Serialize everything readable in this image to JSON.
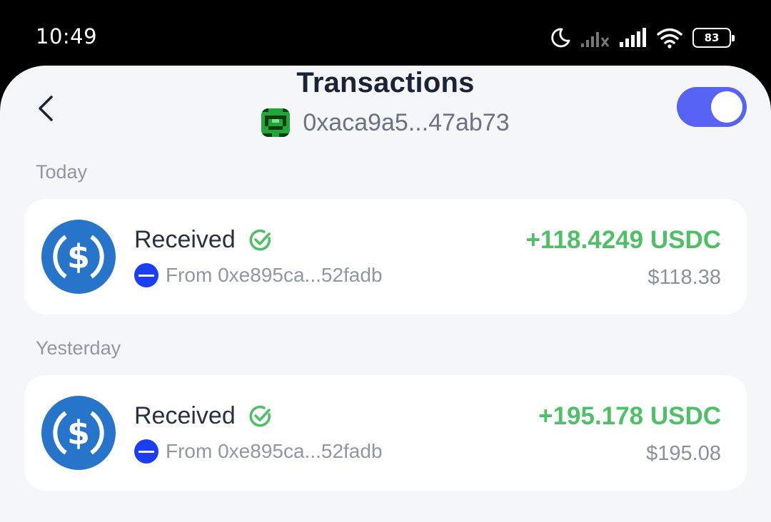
{
  "status_bar": {
    "time": "10:49",
    "battery": "83",
    "icons": [
      "moon-icon",
      "signal-off-icon",
      "signal-icon",
      "wifi-icon",
      "battery-icon"
    ]
  },
  "header": {
    "title": "Transactions",
    "address": "0xaca9a5...47ab73",
    "toggle_on": true,
    "accent_color": "#5663f4"
  },
  "sections": [
    {
      "label": "Today",
      "transactions": [
        {
          "type": "Received",
          "from": "From 0xe895ca...52fadb",
          "amount": "+118.4249 USDC",
          "fiat": "$118.38",
          "status": "confirmed",
          "token_icon": "usdc-icon"
        }
      ]
    },
    {
      "label": "Yesterday",
      "transactions": [
        {
          "type": "Received",
          "from": "From 0xe895ca...52fadb",
          "amount": "+195.178 USDC",
          "fiat": "$195.08",
          "status": "confirmed",
          "token_icon": "usdc-icon"
        }
      ]
    }
  ],
  "colors": {
    "positive": "#4fbf68",
    "usdc_blue": "#2775ca",
    "sender_badge": "#1b3ff0"
  }
}
